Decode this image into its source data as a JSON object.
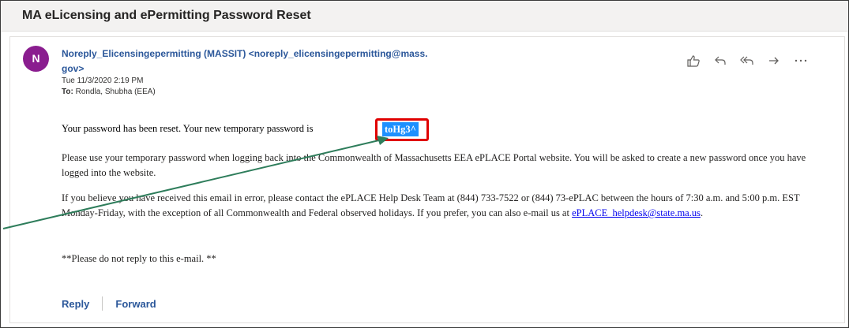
{
  "email": {
    "subject": "MA eLicensing and ePermitting Password Reset",
    "avatar_initial": "N",
    "sender_line1": "Noreply_Elicensingepermitting (MASSIT) <noreply_elicensingepermitting@mass.",
    "sender_line2": "gov>",
    "date": "Tue 11/3/2020 2:19 PM",
    "to_label": "To:",
    "to_value": "Rondla, Shubha (EEA)"
  },
  "actions": [
    {
      "name": "like-icon"
    },
    {
      "name": "reply-icon"
    },
    {
      "name": "reply-all-icon"
    },
    {
      "name": "forward-icon"
    },
    {
      "name": "more-icon"
    }
  ],
  "body": {
    "p1_prefix": "Your password has been reset.  Your new temporary password is",
    "password": "toHg3^",
    "p2": "Please use your temporary password when logging back into the Commonwealth of Massachusetts EEA ePLACE Portal website.  You will be asked to create a new password once you have logged into the website.",
    "p3_prefix": "If you believe you have received this email in error, please contact the ePLACE Help Desk Team at (844) 733-7522 or (844) 73-ePLAC between the hours of 7:30 a.m. and 5:00 p.m. EST Monday-Friday, with the exception of all Commonwealth and Federal observed holidays. If you prefer, you can also e-mail us at",
    "p3_link": "ePLACE_helpdesk@state.ma.us",
    "p3_suffix": ".",
    "p4": "**Please do not reply to this e-mail. **"
  },
  "footer": {
    "reply_label": "Reply",
    "forward_label": "Forward"
  },
  "colors": {
    "avatar": "#8a1d8f",
    "accent": "#2b579a",
    "highlight_box": "#e00000",
    "password_bg": "#1e90ff",
    "arrow": "#2e7d5b"
  }
}
